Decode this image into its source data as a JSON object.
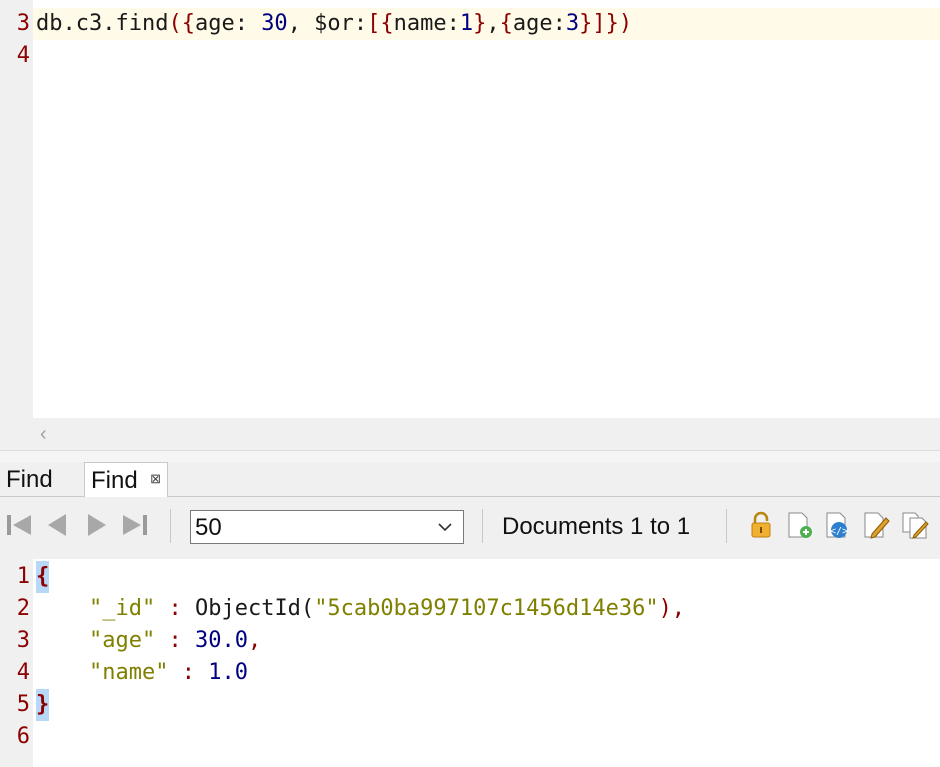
{
  "editor": {
    "lines": [
      {
        "number": "3",
        "text": "db.c3.find({age: 30, $or:[{name:1},{age:3}]})"
      },
      {
        "number": "4",
        "text": ""
      }
    ],
    "scroll_left_glyph": "‹"
  },
  "tabs": [
    {
      "label": "Find",
      "active": false
    },
    {
      "label": "Find",
      "active": true,
      "close_glyph": "⊠"
    }
  ],
  "toolbar": {
    "page_size": "50",
    "documents_label": "Documents 1 to 1",
    "icons": [
      "first-page-icon",
      "previous-page-icon",
      "next-page-icon",
      "last-page-icon",
      "lock-icon",
      "new-document-icon",
      "view-json-icon",
      "edit-document-icon",
      "copy-document-icon"
    ]
  },
  "result": {
    "lines": [
      {
        "number": "1",
        "text": "{"
      },
      {
        "number": "2",
        "key": "\"_id\"",
        "sep": " : ",
        "func": "ObjectId(",
        "str": "\"5cab0ba997107c1456d14e36\"",
        "end": "),"
      },
      {
        "number": "3",
        "key": "\"age\"",
        "sep": " : ",
        "value": "30.0",
        "end": ","
      },
      {
        "number": "4",
        "key": "\"name\"",
        "sep": " : ",
        "value": "1.0",
        "end": ""
      },
      {
        "number": "5",
        "text": "}"
      },
      {
        "number": "6",
        "text": ""
      }
    ]
  },
  "colors": {
    "line_number": "#8b0000",
    "key": "#808000",
    "number": "#000080",
    "bracket_highlight": "#b8d8f8",
    "current_line": "#fffbe8"
  }
}
